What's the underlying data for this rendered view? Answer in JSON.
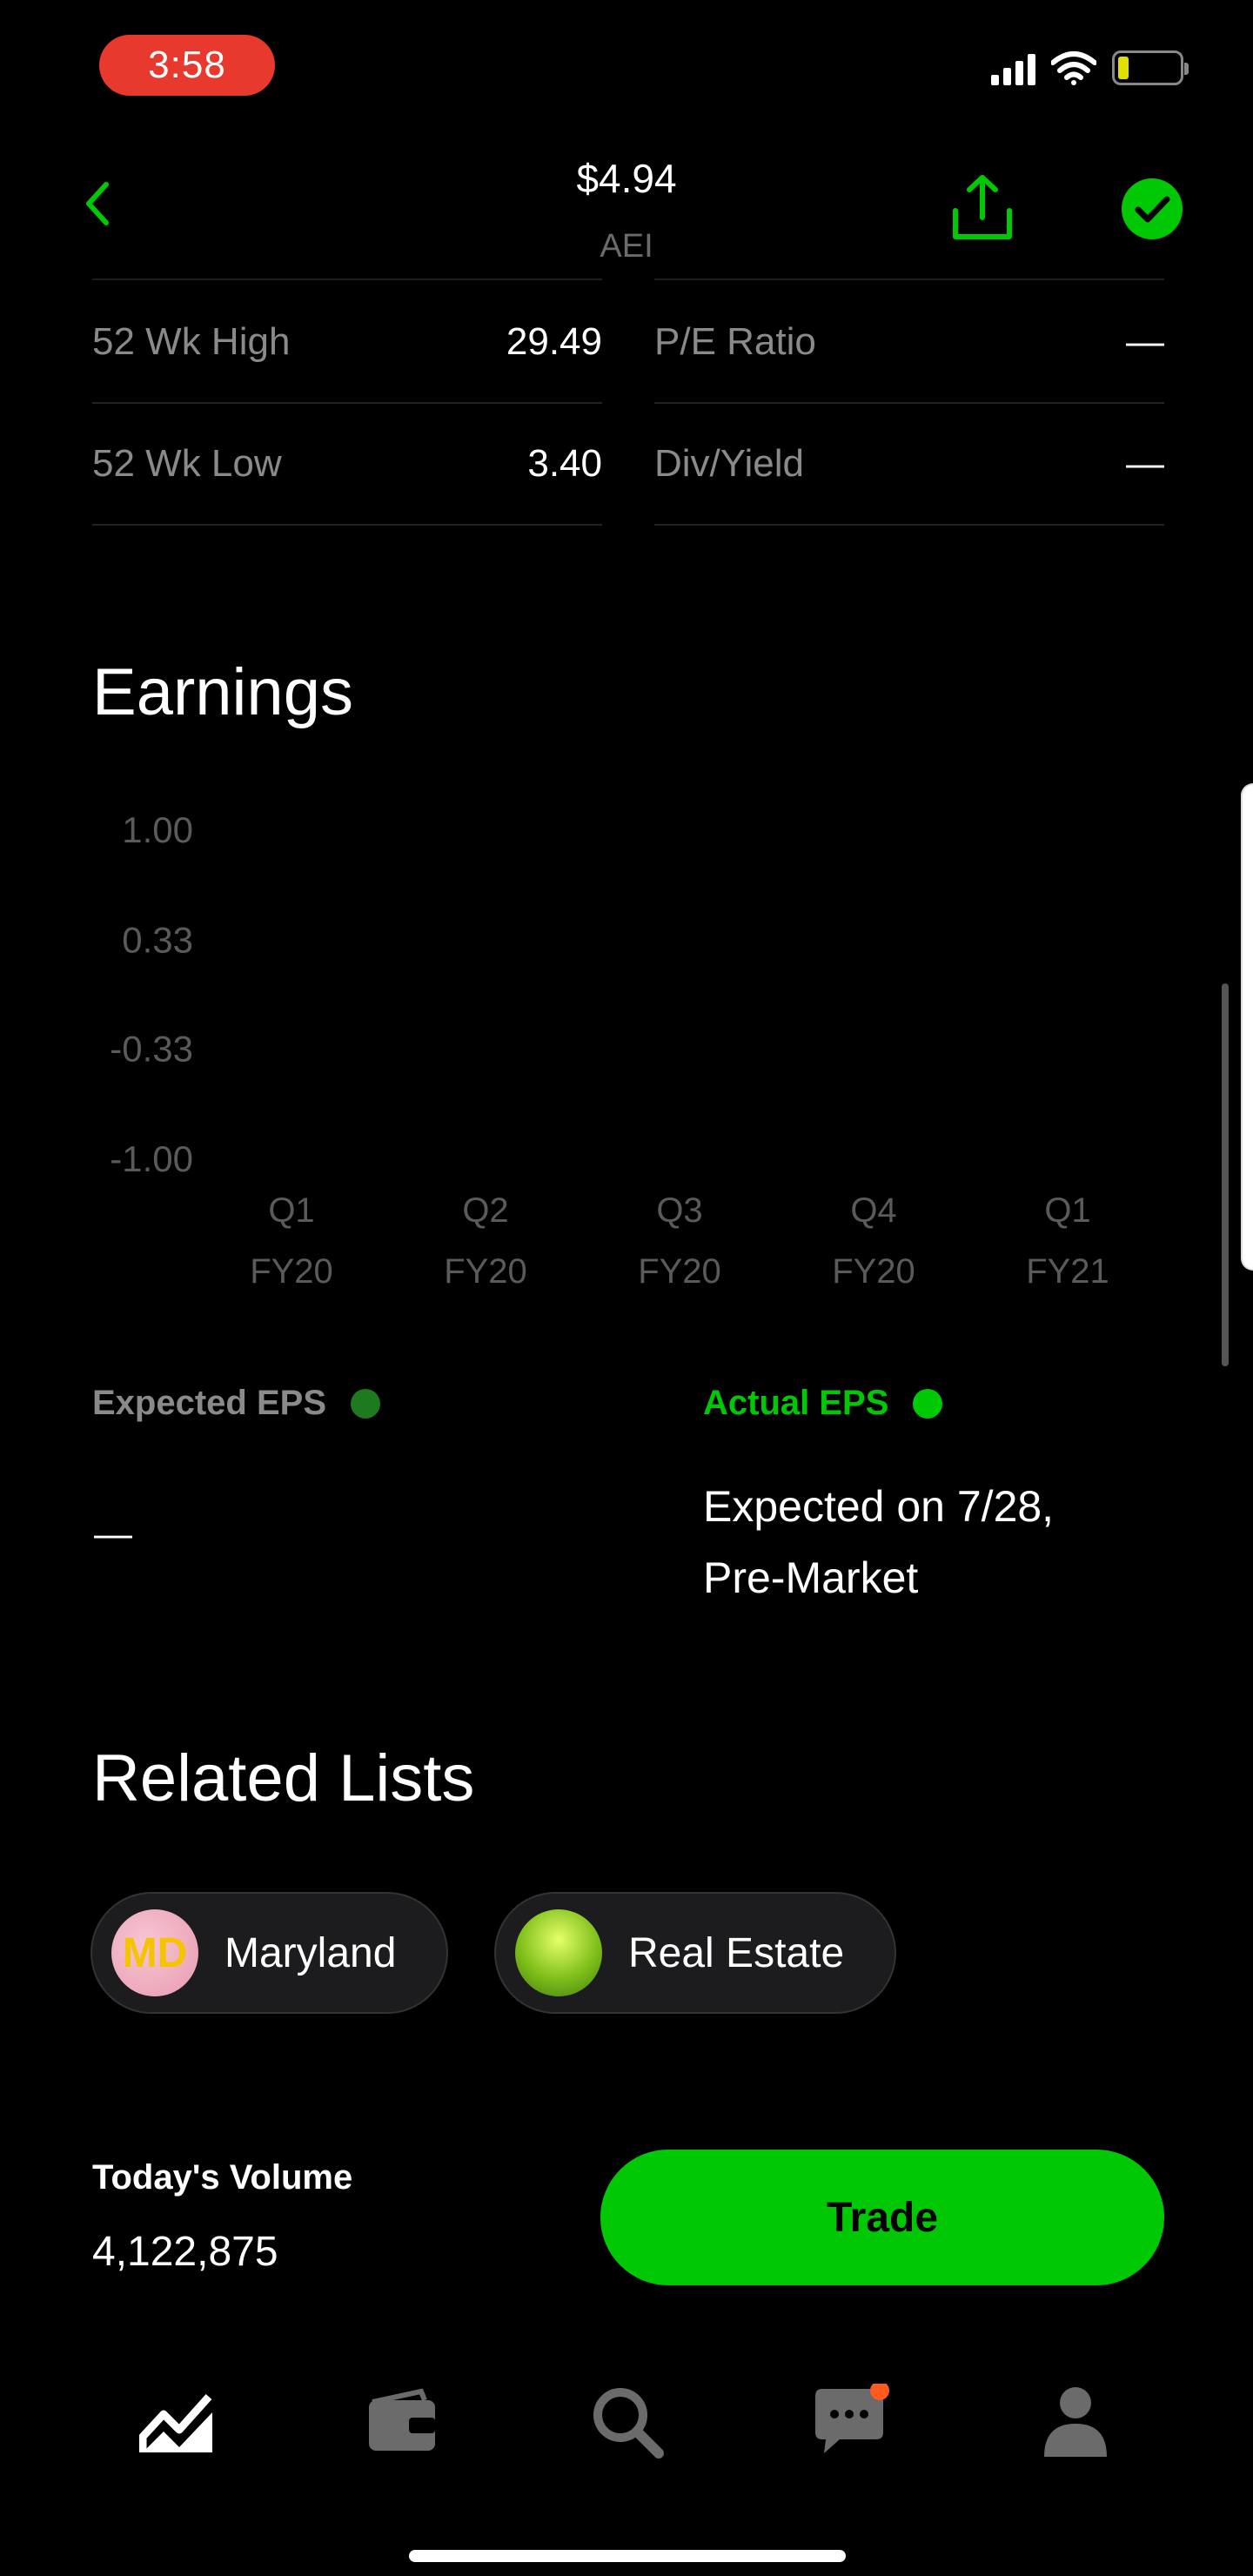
{
  "status_bar": {
    "time": "3:58"
  },
  "header": {
    "price": "$4.94",
    "ticker": "AEI"
  },
  "stats": {
    "left": [
      {
        "label": "52 Wk High",
        "value": "29.49"
      },
      {
        "label": "52 Wk Low",
        "value": "3.40"
      }
    ],
    "right": [
      {
        "label": "P/E Ratio",
        "value": "—"
      },
      {
        "label": "Div/Yield",
        "value": "—"
      }
    ]
  },
  "earnings": {
    "title": "Earnings",
    "expected_label": "Expected EPS",
    "actual_label": "Actual EPS",
    "expected_value": "—",
    "actual_line1": "Expected on 7/28,",
    "actual_line2": "Pre-Market",
    "expected_color": "#1e7a1e",
    "actual_color": "#00c805"
  },
  "chart_data": {
    "type": "scatter",
    "title": "",
    "xlabel": "",
    "ylabel": "",
    "categories": [
      "Q1 FY20",
      "Q2 FY20",
      "Q3 FY20",
      "Q4 FY20",
      "Q1 FY21"
    ],
    "category_lines": [
      [
        "Q1",
        "FY20"
      ],
      [
        "Q2",
        "FY20"
      ],
      [
        "Q3",
        "FY20"
      ],
      [
        "Q4",
        "FY20"
      ],
      [
        "Q1",
        "FY21"
      ]
    ],
    "y_ticks": [
      "1.00",
      "0.33",
      "-0.33",
      "-1.00"
    ],
    "ylim": [
      -1.0,
      1.0
    ],
    "series": [
      {
        "name": "Expected EPS",
        "values": [
          null,
          null,
          null,
          null,
          null
        ]
      },
      {
        "name": "Actual EPS",
        "values": [
          null,
          null,
          null,
          null,
          null
        ]
      }
    ],
    "grid": false
  },
  "related": {
    "title": "Related Lists",
    "chips": [
      {
        "label": "Maryland",
        "thumb_text": "MD"
      },
      {
        "label": "Real Estate"
      }
    ]
  },
  "footer": {
    "volume_label": "Today's Volume",
    "volume_value": "4,122,875",
    "trade_label": "Trade"
  },
  "tabs": [
    {
      "name": "chart-icon"
    },
    {
      "name": "wallet-icon"
    },
    {
      "name": "search-icon"
    },
    {
      "name": "messages-icon"
    },
    {
      "name": "account-icon"
    }
  ],
  "colors": {
    "accent": "#00c805",
    "background": "#000000",
    "notification": "#ff5a1f"
  }
}
